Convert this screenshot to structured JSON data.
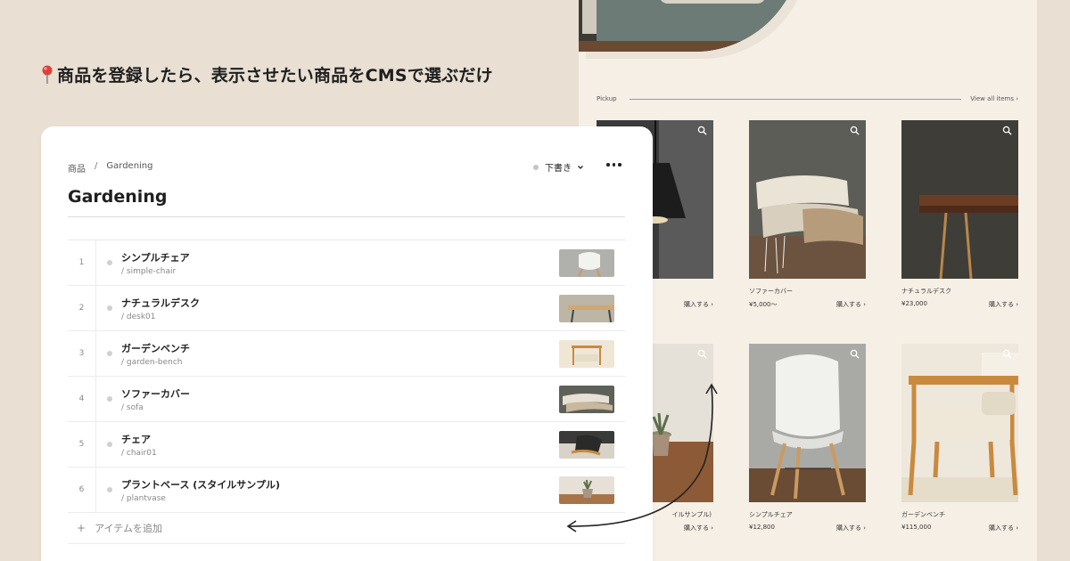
{
  "tagline": "商品を登録したら、表示させたい商品をCMSで選ぶだけ",
  "cms": {
    "breadcrumb": {
      "root": "商品",
      "separator": "/",
      "current": "Gardening"
    },
    "status_label": "下書き",
    "title": "Gardening",
    "items": [
      {
        "num": "1",
        "name": "シンプルチェア",
        "slug": "/ simple-chair"
      },
      {
        "num": "2",
        "name": "ナチュラルデスク",
        "slug": "/ desk01"
      },
      {
        "num": "3",
        "name": "ガーデンベンチ",
        "slug": "/ garden-bench"
      },
      {
        "num": "4",
        "name": "ソファーカバー",
        "slug": "/ sofa"
      },
      {
        "num": "5",
        "name": "チェア",
        "slug": "/ chair01"
      },
      {
        "num": "6",
        "name": "プラントベース (スタイルサンプル)",
        "slug": "/ plantvase"
      }
    ],
    "add_item_label": "アイテムを追加",
    "add_icon": "+"
  },
  "store": {
    "pickup_label": "Pickup",
    "view_all_label": "View all items ›",
    "buy_label": "購入する ›",
    "products": [
      {
        "name": "",
        "price": ""
      },
      {
        "name": "ソファーカバー",
        "price": "¥5,000〜"
      },
      {
        "name": "ナチュラルデスク",
        "price": "¥23,000"
      },
      {
        "name": "イルサンプル)",
        "price": ""
      },
      {
        "name": "シンプルチェア",
        "price": "¥12,800"
      },
      {
        "name": "ガーデンベンチ",
        "price": "¥115,000"
      }
    ]
  },
  "colors": {
    "page_bg": "#e9e0d3",
    "store_bg": "#f5efe6",
    "panel_bg": "#ffffff",
    "text": "#1f1f1f"
  }
}
